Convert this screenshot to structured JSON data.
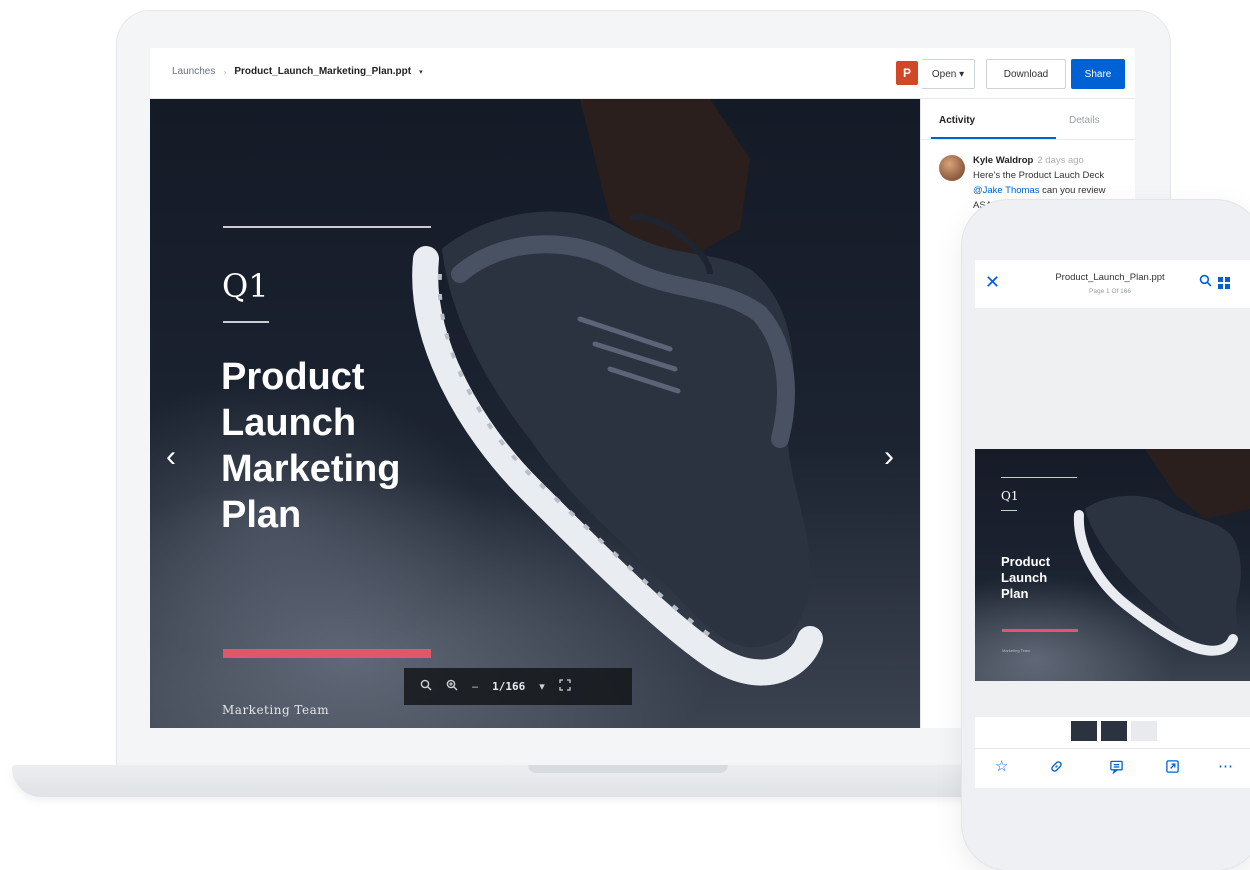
{
  "breadcrumb": {
    "folder": "Launches",
    "separator": "›",
    "file": "Product_Launch_Marketing_Plan.ppt",
    "caret": "▾"
  },
  "toolbar": {
    "ppt_icon": "P",
    "open_label": "Open ▾",
    "download_label": "Download",
    "share_label": "Share"
  },
  "slide": {
    "quarter": "Q1",
    "title_lines": [
      "Product",
      "Launch",
      "Marketing",
      "Plan"
    ],
    "team": "Marketing Team",
    "prev": "‹",
    "next": "›"
  },
  "viewer_controls": {
    "zoom_out": "🔍",
    "zoom_in": "⊕",
    "prev_page": "–",
    "page": "1/166",
    "page_caret": "▾",
    "fullscreen": "⛶"
  },
  "sidebar": {
    "tabs": [
      {
        "label": "Activity"
      },
      {
        "label": "Details"
      }
    ],
    "comment": {
      "author": "Kyle Waldrop",
      "time": "2 days ago",
      "line1": "Here's the Product Lauch Deck",
      "mention": "@Jake Thomas",
      "line2_rest": " can you review ASAP?"
    }
  },
  "phone": {
    "close": "✕",
    "title": "Product_Launch_Plan.ppt",
    "subtitle": "Page 1 Of 166",
    "search": "⌕",
    "slide": {
      "quarter": "Q1",
      "title_lines": [
        "Product",
        "Launch",
        "Plan"
      ],
      "team": "Marketing Team"
    },
    "actions": {
      "star": "☆",
      "link": "🔗",
      "comment": "💬",
      "open_in": "⇱",
      "more": "⋯"
    }
  },
  "colors": {
    "accent": "#0061d5",
    "slide_bar": "#e0576a",
    "ppt": "#d24726"
  }
}
